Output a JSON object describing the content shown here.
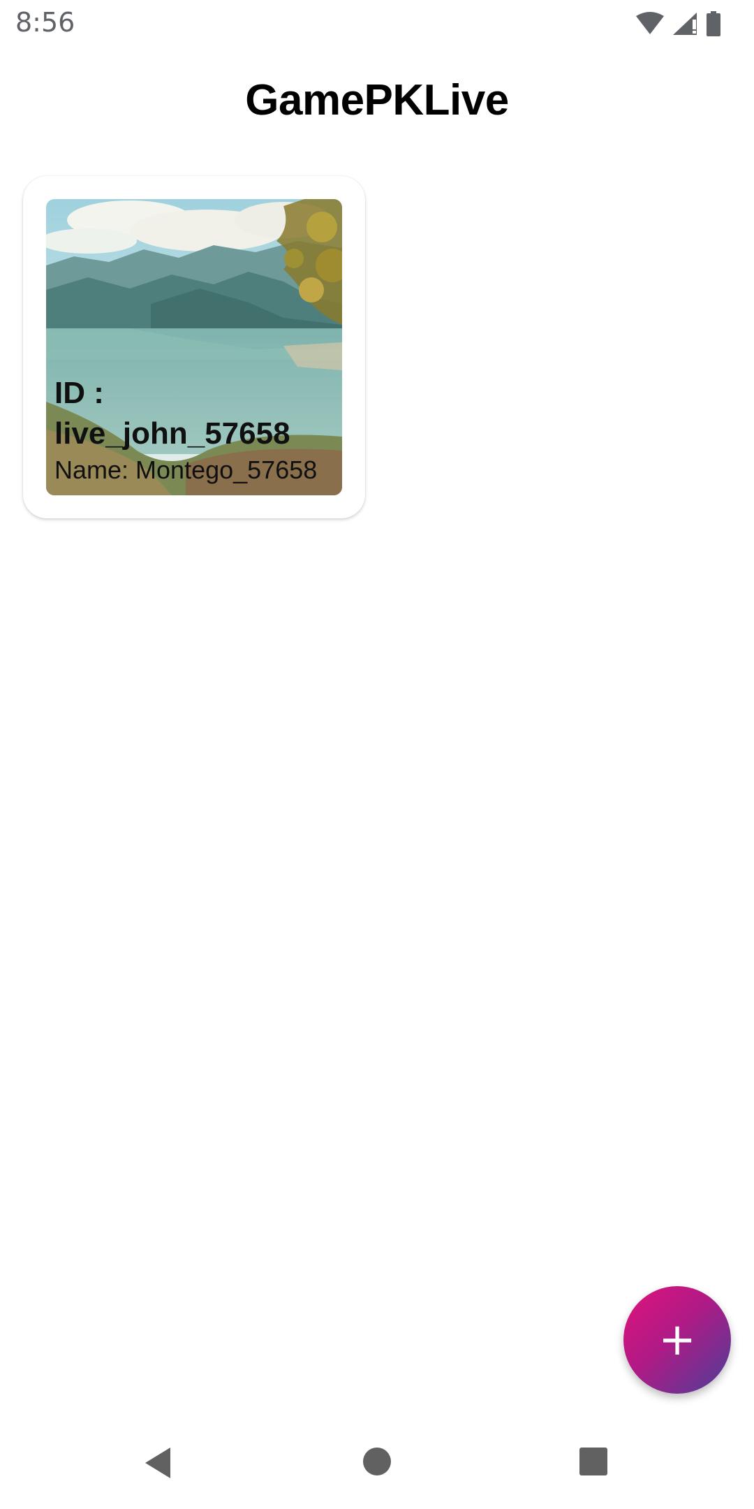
{
  "status_bar": {
    "time": "8:56",
    "icons": [
      "wifi-icon",
      "cellular-signal-icon",
      "battery-icon"
    ]
  },
  "header": {
    "title": "GamePKLive"
  },
  "rooms": [
    {
      "id_text": "ID : live_john_57658",
      "name_text": "Name: Montego_57658",
      "image": "lake-mountain-landscape"
    }
  ],
  "fab": {
    "icon": "plus-icon",
    "label": "+",
    "gradient": [
      "#e0137a",
      "#4b3f98"
    ]
  },
  "nav_bar": {
    "icons": [
      "back-icon",
      "home-icon",
      "recents-icon"
    ],
    "color": "#616161"
  }
}
